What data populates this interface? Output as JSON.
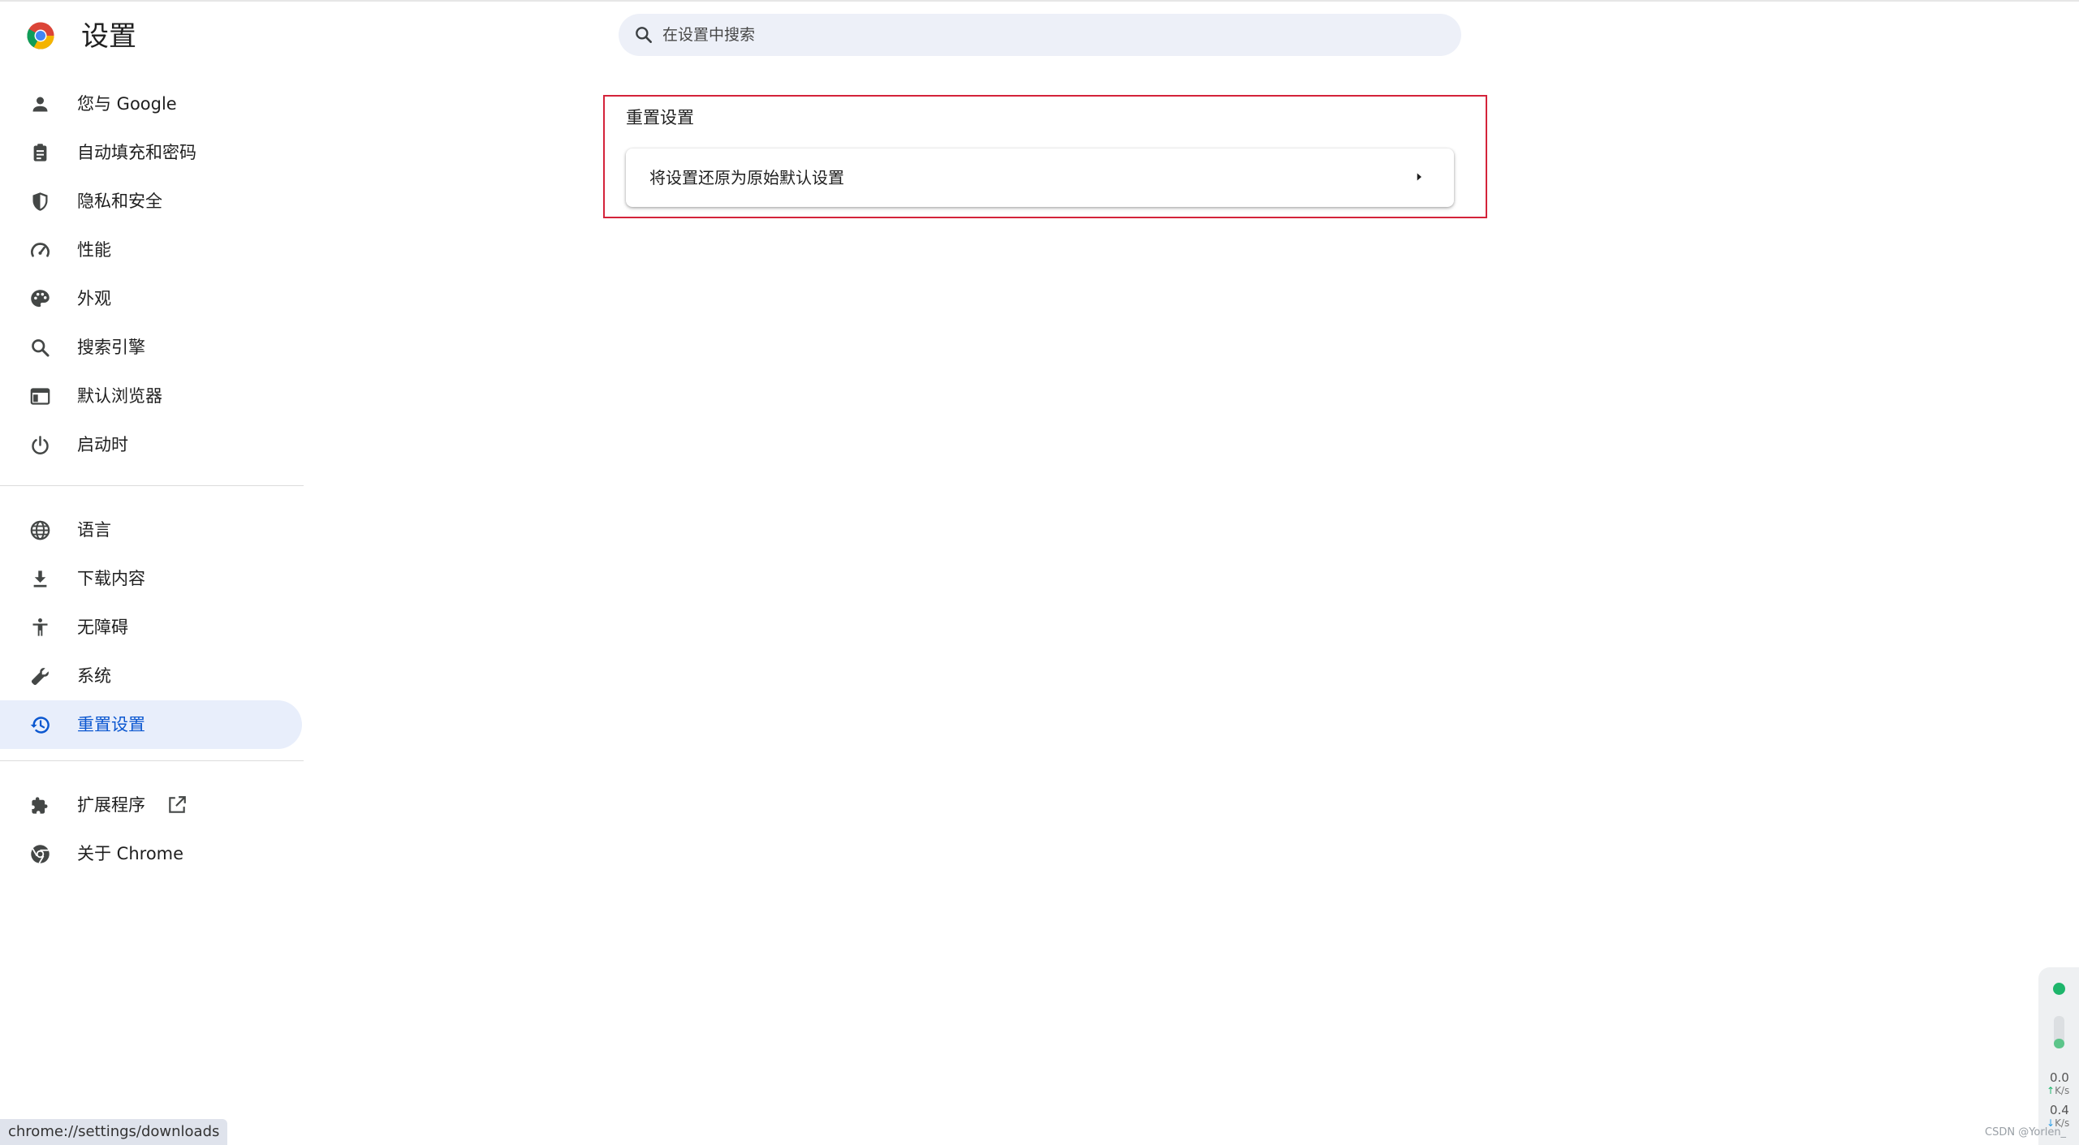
{
  "header": {
    "app_title": "设置",
    "logo_icon": "chrome-logo-icon",
    "search": {
      "placeholder": "在设置中搜索",
      "value": ""
    }
  },
  "sidebar": {
    "group1": [
      {
        "label": "您与 Google",
        "icon": "person-icon"
      },
      {
        "label": "自动填充和密码",
        "icon": "clipboard-icon"
      },
      {
        "label": "隐私和安全",
        "icon": "shield-icon"
      },
      {
        "label": "性能",
        "icon": "speedometer-icon"
      },
      {
        "label": "外观",
        "icon": "palette-icon"
      },
      {
        "label": "搜索引擎",
        "icon": "search-icon"
      },
      {
        "label": "默认浏览器",
        "icon": "browser-window-icon"
      },
      {
        "label": "启动时",
        "icon": "power-icon"
      }
    ],
    "group2": [
      {
        "label": "语言",
        "icon": "globe-icon"
      },
      {
        "label": "下载内容",
        "icon": "download-icon"
      },
      {
        "label": "无障碍",
        "icon": "accessibility-icon"
      },
      {
        "label": "系统",
        "icon": "wrench-icon"
      },
      {
        "label": "重置设置",
        "icon": "history-icon",
        "active": true
      }
    ],
    "group3": [
      {
        "label": "扩展程序",
        "icon": "puzzle-icon",
        "external_icon": "open-in-new-icon"
      },
      {
        "label": "关于 Chrome",
        "icon": "chrome-outline-icon"
      }
    ]
  },
  "main": {
    "section_title": "重置设置",
    "rows": [
      {
        "label": "将设置还原为原始默认设置",
        "icon": "arrow-right-icon"
      }
    ]
  },
  "status_bar": {
    "url": "chrome://settings/downloads"
  },
  "net_widget": {
    "upload_value": "0.0",
    "upload_unit": "K/s",
    "download_value": "0.4",
    "download_unit": "K/s",
    "status_color": "#1db56b",
    "level": 0.3
  },
  "watermark": "CSDN @Yorlen_",
  "colors": {
    "accent": "#0b57d0",
    "active_bg": "#e8eefb",
    "highlight_border": "#d4233a",
    "search_bg": "#edf0f8"
  }
}
